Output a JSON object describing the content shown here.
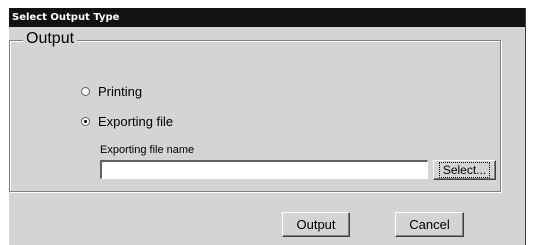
{
  "window": {
    "title": "Select Output Type"
  },
  "group": {
    "legend": "Output"
  },
  "options": [
    {
      "label": "Printing",
      "selected": false
    },
    {
      "label": "Exporting file",
      "selected": true
    }
  ],
  "file": {
    "label": "Exporting file name",
    "value": "",
    "select_label": "Select..."
  },
  "buttons": {
    "output": "Output",
    "cancel": "Cancel"
  }
}
